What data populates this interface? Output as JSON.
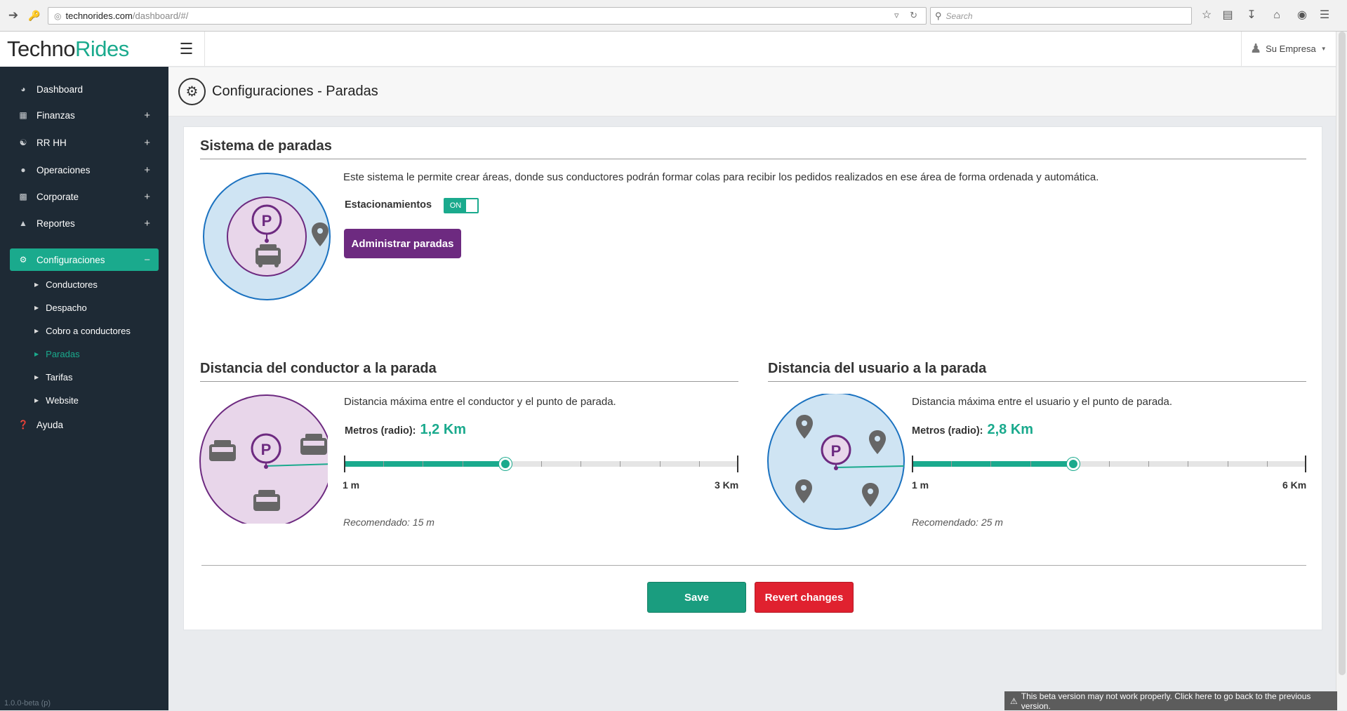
{
  "browser": {
    "url_host": "technorides.com",
    "url_path": "/dashboard/#/",
    "search_placeholder": "Search"
  },
  "brand": {
    "name_part1": "Techno",
    "name_part2": "Rides",
    "accent": "#1aaa8d"
  },
  "sidebar": {
    "items": [
      {
        "label": "Dashboard",
        "icon": "dashboard-icon",
        "expandable": false
      },
      {
        "label": "Finanzas",
        "icon": "calculator-icon",
        "expandable": true
      },
      {
        "label": "RR HH",
        "icon": "users-icon",
        "expandable": true
      },
      {
        "label": "Operaciones",
        "icon": "map-marker-icon",
        "expandable": true
      },
      {
        "label": "Corporate",
        "icon": "briefcase-icon",
        "expandable": true
      },
      {
        "label": "Reportes",
        "icon": "area-chart-icon",
        "expandable": true
      },
      {
        "label": "Configuraciones",
        "icon": "gear-icon",
        "expandable": true,
        "active": true,
        "toggle": "−"
      },
      {
        "label": "Ayuda",
        "icon": "help-icon",
        "expandable": false
      }
    ],
    "plus": "+",
    "submenu": [
      "Conductores",
      "Despacho",
      "Cobro a conductores",
      "Paradas",
      "Tarifas",
      "Website"
    ],
    "active_sub": "Paradas",
    "version": "1.0.0-beta (p)"
  },
  "topbar": {
    "user": "Su Empresa"
  },
  "page": {
    "title": "Configuraciones - Paradas"
  },
  "stops": {
    "title": "Sistema de paradas",
    "description": "Este sistema le permite crear áreas, donde sus conductores podrán formar colas para recibir los pedidos realizados en ese área de forma ordenada y automática.",
    "parking_label": "Estacionamientos",
    "parking_toggle": "ON",
    "manage_button": "Administrar paradas"
  },
  "driver_distance": {
    "title": "Distancia del conductor a la parada",
    "description": "Distancia máxima entre el conductor y el punto de parada.",
    "value_label": "Metros (radio):",
    "value": "1,2 Km",
    "fraction": 0.41,
    "min_label": "1 m",
    "max_label": "3 Km",
    "recommended": "Recomendado: 15 m"
  },
  "user_distance": {
    "title": "Distancia del usuario a la parada",
    "description": "Distancia máxima entre el usuario y el punto de parada.",
    "value_label": "Metros (radio):",
    "value": "2,8 Km",
    "fraction": 0.41,
    "min_label": "1 m",
    "max_label": "6 Km",
    "recommended": "Recomendado: 25 m"
  },
  "actions": {
    "save": "Save",
    "revert": "Revert changes"
  },
  "beta_notice": "This beta version may not work properly. Click here to go back to the previous version.",
  "colors": {
    "teal": "#1aaa8d",
    "purple": "#6d2a80",
    "red": "#e0212f",
    "sidebar": "#1e2a35"
  }
}
